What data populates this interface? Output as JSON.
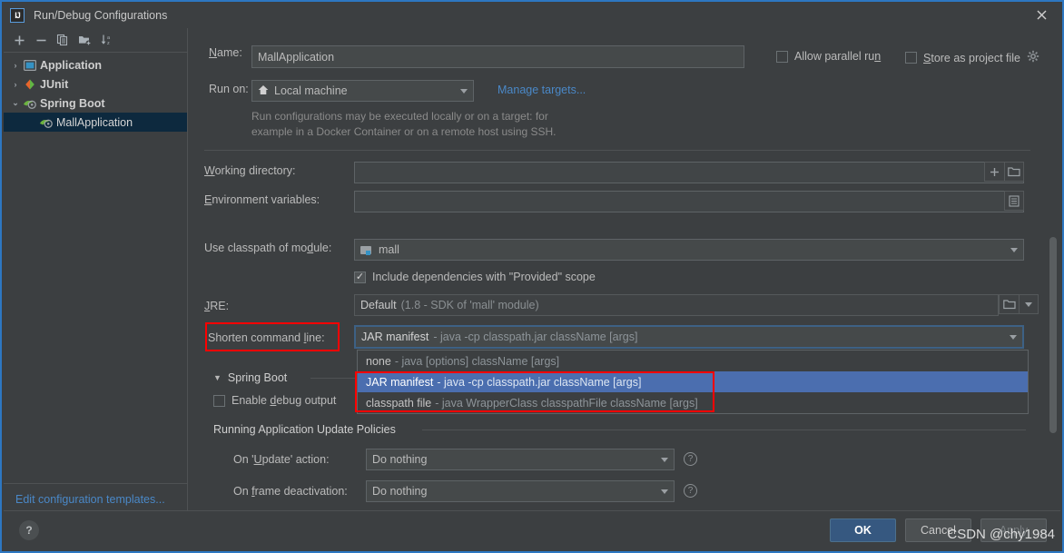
{
  "window": {
    "title": "Run/Debug Configurations",
    "app_icon": "IJ",
    "close_icon": "close-icon"
  },
  "left_panel": {
    "toolbar": [
      {
        "name": "add-configuration-button",
        "glyph": "+"
      },
      {
        "name": "remove-configuration-button",
        "glyph": "−"
      },
      {
        "name": "copy-configuration-button",
        "glyph": "copy-icon"
      },
      {
        "name": "new-folder-button",
        "glyph": "folder-add-icon"
      },
      {
        "name": "sort-configurations-button",
        "glyph": "sort-alpha-icon"
      }
    ],
    "tree": [
      {
        "label": "Application",
        "twisty": "›",
        "icon": "application-icon",
        "level": 1,
        "selected": false,
        "bold": true
      },
      {
        "label": "JUnit",
        "twisty": "›",
        "icon": "junit-icon",
        "level": 1,
        "selected": false,
        "bold": true
      },
      {
        "label": "Spring Boot",
        "twisty": "⌄",
        "icon": "spring-boot-icon",
        "level": 1,
        "selected": false,
        "bold": true
      },
      {
        "label": "MallApplication",
        "twisty": "",
        "icon": "spring-boot-icon",
        "level": 2,
        "selected": true,
        "bold": false
      }
    ],
    "edit_templates_link": "Edit configuration templates..."
  },
  "form": {
    "name_label": "Name:",
    "name_label_mnemonic": "N",
    "name_value": "MallApplication",
    "allow_parallel_run_label": "Allow parallel run",
    "allow_parallel_run_mnemonic": "n",
    "allow_parallel_run_checked": false,
    "store_as_project_file_label": "Store as project file",
    "store_as_project_file_mnemonic": "S",
    "store_as_project_file_checked": false,
    "store_gear_icon": "gear-icon",
    "run_on_label": "Run on:",
    "run_on_value": "Local machine",
    "run_on_icon": "home-icon",
    "manage_targets_link": "Manage targets...",
    "run_on_hint_line1": "Run configurations may be executed locally or on a target: for",
    "run_on_hint_line2": "example in a Docker Container or on a remote host using SSH.",
    "working_directory_label": "Working directory:",
    "working_directory_mnemonic": "W",
    "working_directory_value": "",
    "working_directory_insert_icon": "plus-icon",
    "working_directory_browse_icon": "folder-icon",
    "environment_variables_label": "Environment variables:",
    "environment_variables_mnemonic": "E",
    "environment_variables_value": "",
    "environment_variables_edit_icon": "list-edit-icon",
    "use_classpath_label": "Use classpath of module:",
    "use_classpath_mnemonic": "d",
    "use_classpath_value": "mall",
    "use_classpath_icon": "module-icon",
    "include_provided_label": "Include dependencies with \"Provided\" scope",
    "include_provided_checked": true,
    "jre_label": "JRE:",
    "jre_mnemonic": "J",
    "jre_value_bold": "Default",
    "jre_value_muted": "(1.8 - SDK of 'mall' module)",
    "jre_browse_icon": "folder-icon",
    "shorten_command_line_label": "Shorten command line:",
    "shorten_command_line_mnemonic": "l",
    "shorten_command_line_value_bold": "JAR manifest",
    "shorten_command_line_value_muted": "- java -cp classpath.jar className [args]",
    "spring_boot_section": "Spring Boot",
    "enable_debug_output_label": "Enable debug output",
    "enable_debug_output_mnemonic": "d",
    "enable_debug_output_checked": false,
    "update_policies_section": "Running Application Update Policies",
    "on_update_action_label": "On 'Update' action:",
    "on_update_action_mnemonic": "U",
    "on_update_action_value": "Do nothing",
    "on_frame_deactivation_label": "On frame deactivation:",
    "on_frame_deactivation_mnemonic": "f",
    "on_frame_deactivation_value": "Do nothing",
    "help_icon": "help-icon"
  },
  "dropdown": {
    "open": true,
    "items": [
      {
        "bold": "none",
        "muted": "- java [options] className [args]",
        "selected": false
      },
      {
        "bold": "JAR manifest",
        "muted": "- java -cp classpath.jar className [args]",
        "selected": true
      },
      {
        "bold": "classpath file",
        "muted": "- java WrapperClass classpathFile className [args]",
        "selected": false
      }
    ]
  },
  "footer": {
    "help_button": "?",
    "ok_button": "OK",
    "cancel_button": "Cancel",
    "apply_button": "Apply"
  },
  "watermark": "CSDN @chy1984",
  "colors": {
    "window_bg": "#3c3f41",
    "accent_border": "#2d77c2",
    "link": "#4a88c7",
    "selection_blue": "#4b6eaf",
    "tree_selection": "#0d293e",
    "annotation_red": "#ff0000",
    "primary_button": "#365880"
  }
}
